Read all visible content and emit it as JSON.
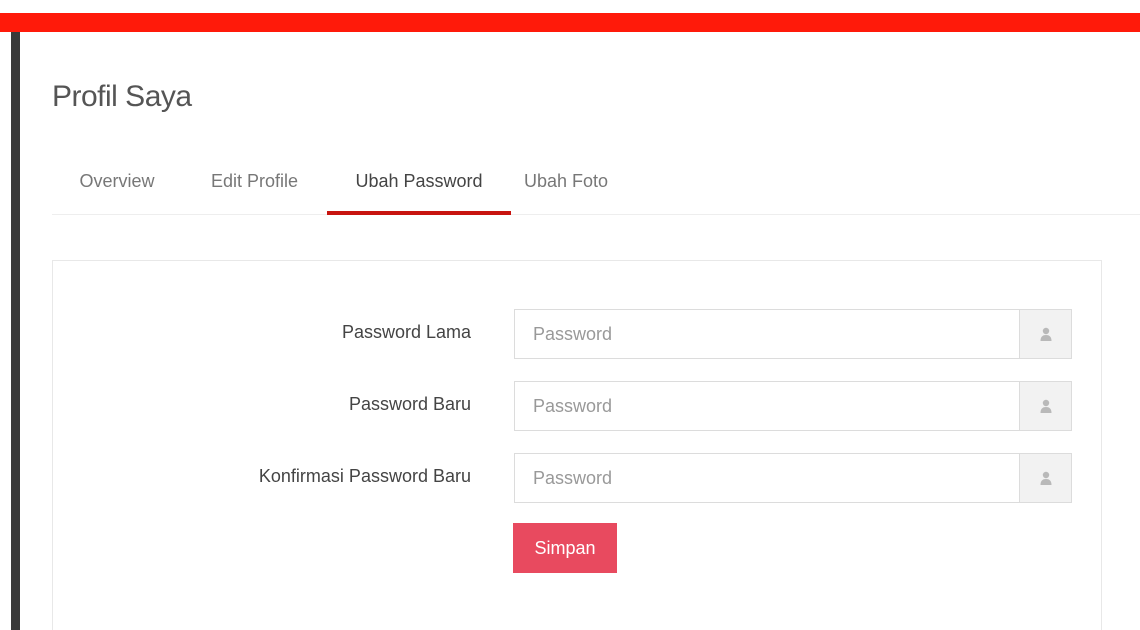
{
  "colors": {
    "top_bar": "#ff1a0a",
    "tab_active_underline": "#c8140f",
    "save_button": "#e84a5f",
    "left_strip": "#3a3a3a"
  },
  "page": {
    "title": "Profil Saya"
  },
  "tabs": [
    {
      "label": "Overview",
      "active": false
    },
    {
      "label": "Edit Profile",
      "active": false
    },
    {
      "label": "Ubah Password",
      "active": true
    },
    {
      "label": "Ubah Foto",
      "active": false
    }
  ],
  "form": {
    "fields": [
      {
        "label": "Password Lama",
        "placeholder": "Password",
        "value": "",
        "icon": "user-icon"
      },
      {
        "label": "Password Baru",
        "placeholder": "Password",
        "value": "",
        "icon": "user-icon"
      },
      {
        "label": "Konfirmasi Password Baru",
        "placeholder": "Password",
        "value": "",
        "icon": "user-icon"
      }
    ],
    "submit_label": "Simpan"
  }
}
